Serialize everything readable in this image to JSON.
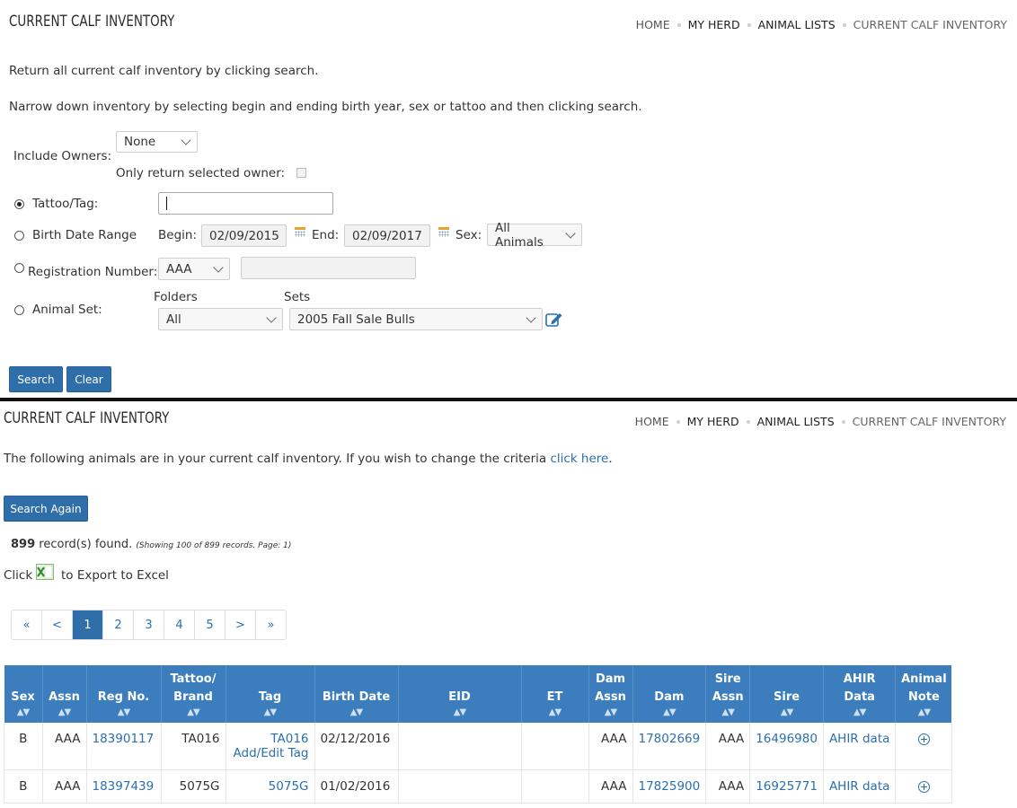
{
  "search_form": {
    "title": "CURRENT CALF INVENTORY",
    "breadcrumbs": [
      "HOME",
      "MY HERD",
      "ANIMAL LISTS",
      "CURRENT CALF INVENTORY"
    ],
    "intro_1": "Return all current calf inventory by clicking search.",
    "intro_2": "Narrow down inventory by selecting begin and ending birth year, sex or tattoo and then clicking search.",
    "include_owners_label": "Include Owners:",
    "owners_value": "None",
    "only_selected_owner_label": "Only return selected owner:",
    "only_selected_owner_checked": false,
    "tattoo_label": "Tattoo/Tag:",
    "tattoo_value": "",
    "birth_range_label": "Birth Date Range",
    "begin_label": "Begin:",
    "begin_value": "02/09/2015",
    "end_label": "End:",
    "end_value": "02/09/2017",
    "sex_label": "Sex:",
    "sex_value": "All Animals",
    "reg_label": "Registration Number:",
    "reg_assn_value": "AAA",
    "reg_value": "",
    "animal_set_label": "Animal Set:",
    "folders_label": "Folders",
    "folders_value": "All",
    "sets_label": "Sets",
    "sets_value": "2005 Fall Sale Bulls",
    "selected_radio": "tattoo",
    "search_btn": "Search",
    "clear_btn": "Clear"
  },
  "results": {
    "title": "CURRENT CALF INVENTORY",
    "breadcrumbs": [
      "HOME",
      "MY HERD",
      "ANIMAL LISTS",
      "CURRENT CALF INVENTORY"
    ],
    "sentence_prefix": "The following animals are in your current calf inventory. If you wish to change the criteria",
    "sentence_link": "click here",
    "sentence_suffix": ".",
    "search_again_btn": "Search Again",
    "record_count": "899",
    "record_text": "record(s) found.",
    "record_detail": "(Showing 100 of 899 records. Page: 1)",
    "export_prefix": "Click",
    "export_suffix": "to Export to Excel",
    "pages": [
      "«",
      "<",
      "1",
      "2",
      "3",
      "4",
      "5",
      ">",
      "»"
    ],
    "active_page": "1",
    "columns": [
      {
        "l1": "",
        "l2": "Sex"
      },
      {
        "l1": "",
        "l2": "Assn"
      },
      {
        "l1": "",
        "l2": "Reg No."
      },
      {
        "l1": "Tattoo/",
        "l2": "Brand"
      },
      {
        "l1": "",
        "l2": "Tag"
      },
      {
        "l1": "",
        "l2": "Birth Date"
      },
      {
        "l1": "",
        "l2": "EID"
      },
      {
        "l1": "",
        "l2": "ET"
      },
      {
        "l1": "Dam",
        "l2": "Assn"
      },
      {
        "l1": "",
        "l2": "Dam"
      },
      {
        "l1": "Sire",
        "l2": "Assn"
      },
      {
        "l1": "",
        "l2": "Sire"
      },
      {
        "l1": "AHIR",
        "l2": "Data"
      },
      {
        "l1": "Animal",
        "l2": "Note"
      }
    ],
    "rows": [
      {
        "sex": "B",
        "assn": "AAA",
        "reg": "18390117",
        "tattoo": "TA016",
        "tag": "TA016",
        "tag_link": "Add/Edit Tag",
        "birth": "02/12/2016",
        "eid": "",
        "et": "",
        "dam_assn": "AAA",
        "dam": "17802669",
        "sire_assn": "AAA",
        "sire": "16496980",
        "ahir": "AHIR data"
      },
      {
        "sex": "B",
        "assn": "AAA",
        "reg": "18397439",
        "tattoo": "5075G",
        "tag": "5075G",
        "tag_link": "",
        "birth": "01/02/2016",
        "eid": "",
        "et": "",
        "dam_assn": "AAA",
        "dam": "17825900",
        "sire_assn": "AAA",
        "sire": "16925771",
        "ahir": "AHIR data"
      }
    ],
    "sort_glyph": "^v"
  }
}
